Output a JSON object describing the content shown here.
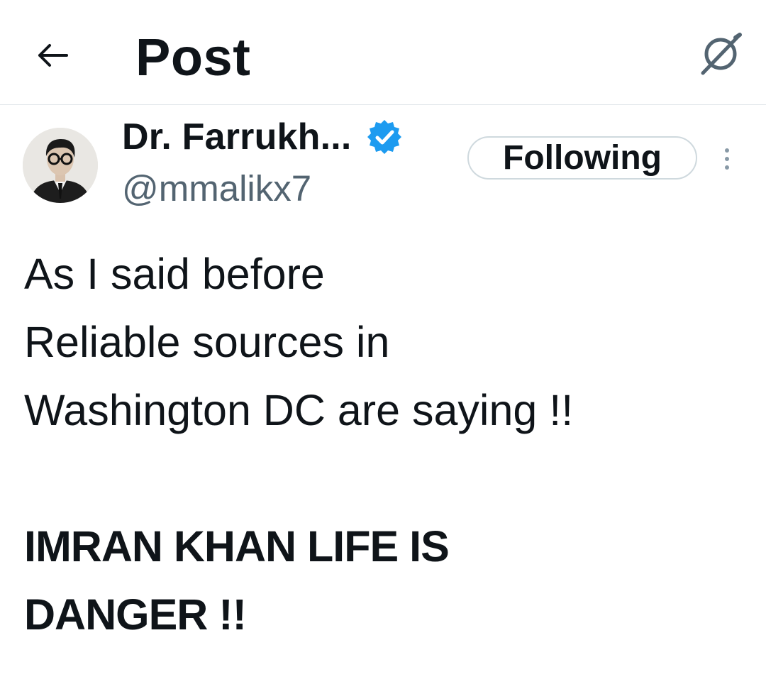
{
  "header": {
    "back_icon": "arrow-left-icon",
    "title": "Post",
    "grok_icon": "grok-icon"
  },
  "author": {
    "display_name": "Dr. Farrukh...",
    "verified_icon": "verified-badge-icon",
    "handle": "@mmalikx7",
    "follow_label": "Following",
    "more_icon": "more-vertical-icon"
  },
  "tweet": {
    "lines": [
      "As I said before",
      "Reliable sources in",
      "Washington DC are saying !!",
      "",
      "IMRAN KHAN LIFE IS",
      "DANGER !!"
    ]
  },
  "colors": {
    "text": "#0f1419",
    "secondary": "#536471",
    "verified_blue": "#1d9bf0",
    "border": "#cfd9de"
  }
}
